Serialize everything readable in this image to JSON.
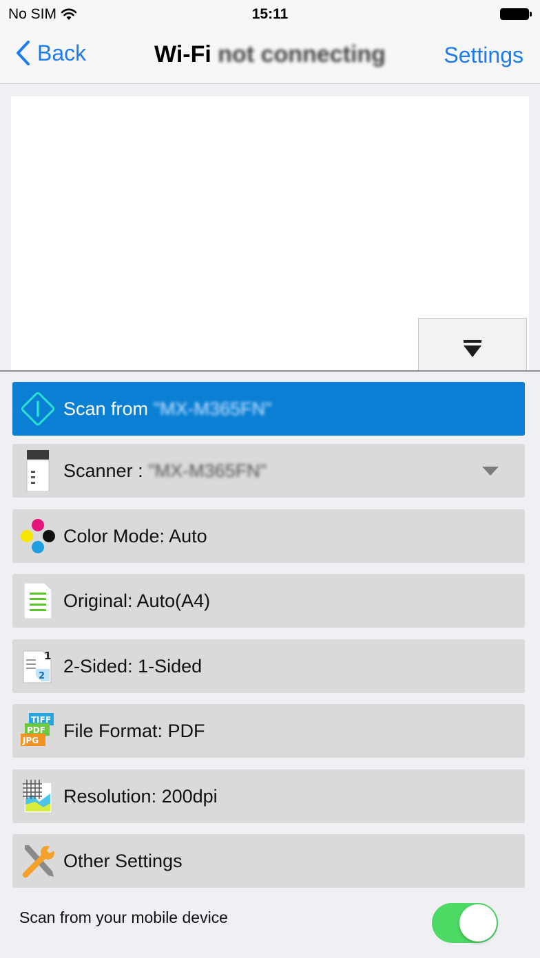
{
  "status_bar": {
    "carrier": "No SIM",
    "time": "15:11"
  },
  "nav": {
    "back_label": "Back",
    "title_main": "Wi-Fi",
    "title_obscured": "not connecting",
    "settings_label": "Settings"
  },
  "scan_button": {
    "label": "Scan from",
    "device": "\"MX-M365FN\""
  },
  "rows": {
    "scanner": {
      "label": "Scanner : ",
      "value": "\"MX-M365FN\""
    },
    "color_mode": {
      "label": "Color Mode: Auto"
    },
    "original": {
      "label": "Original: Auto(A4)"
    },
    "two_sided": {
      "label": "2-Sided: 1-Sided"
    },
    "file_format": {
      "label": "File Format: PDF"
    },
    "resolution": {
      "label": "Resolution: 200dpi"
    },
    "other_settings": {
      "label": "Other Settings"
    }
  },
  "icons": {
    "two_sided_page_front": "1",
    "two_sided_page_back": "2",
    "file_format_tiff": "TIFF",
    "file_format_pdf": "PDF",
    "file_format_jpg": "JPG"
  },
  "footer": {
    "mobile_scan_label": "Scan from your mobile device",
    "mobile_scan_enabled": true
  },
  "colors": {
    "accent": "#1a7bf2",
    "scan_button": "#0a7fd4",
    "toggle_on": "#4cd964",
    "row_bg": "#dadada"
  }
}
